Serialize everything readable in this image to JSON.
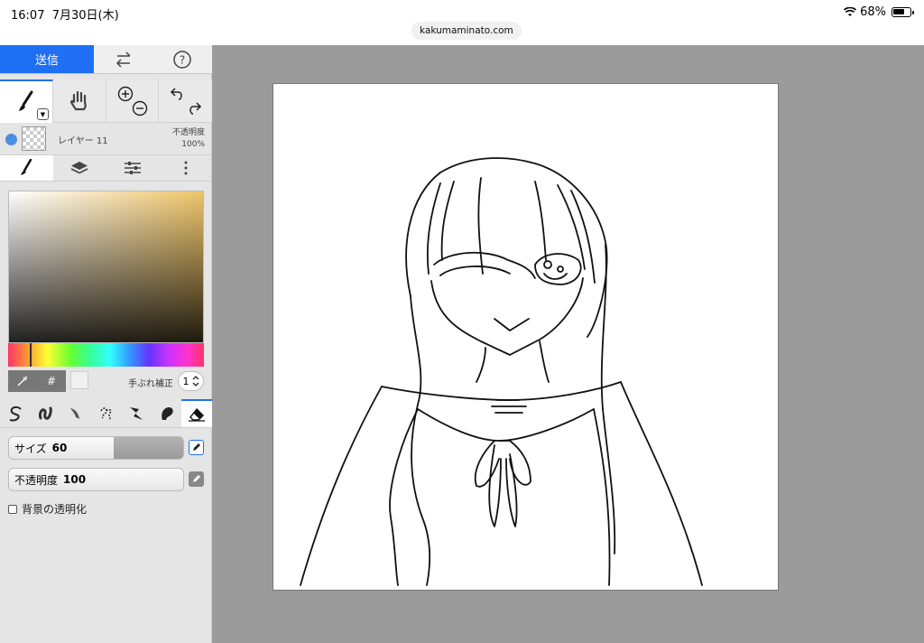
{
  "status": {
    "time": "16:07",
    "date": "7月30日(木)",
    "battery": "68%",
    "battery_level": 0.68
  },
  "browser": {
    "url": "kakumaminato.com"
  },
  "toolbar": {
    "send_label": "送信"
  },
  "layer": {
    "name": "レイヤー 11",
    "opacity_label": "不透明度",
    "opacity_value": "100%"
  },
  "color": {
    "hex_label": "#",
    "stabilizer_label": "手ぶれ補正",
    "stabilizer_value": "1",
    "accent": "#1f6ff5"
  },
  "brush": {
    "size_label": "サイズ",
    "size_value": "60",
    "size_level": 0.6,
    "opacity_label": "不透明度",
    "opacity_value": "100",
    "opacity_level": 1.0,
    "bg_transparent_label": "背景の透明化"
  }
}
